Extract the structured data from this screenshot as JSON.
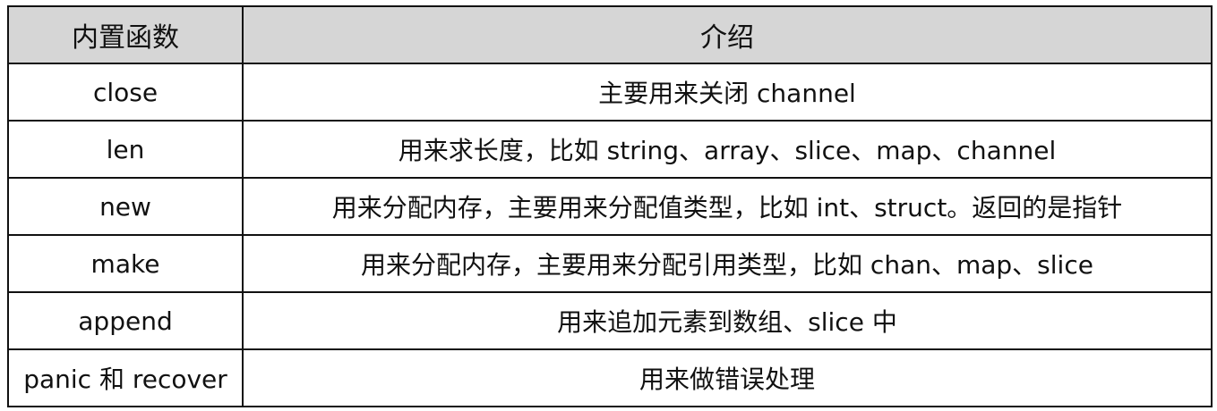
{
  "table": {
    "headers": [
      "内置函数",
      "介绍"
    ],
    "rows": [
      {
        "name": "close",
        "desc": "主要用来关闭 channel"
      },
      {
        "name": "len",
        "desc": "用来求长度，比如 string、array、slice、map、channel"
      },
      {
        "name": "new",
        "desc": "用来分配内存，主要用来分配值类型，比如 int、struct。返回的是指针"
      },
      {
        "name": "make",
        "desc": "用来分配内存，主要用来分配引用类型，比如 chan、map、slice"
      },
      {
        "name": "append",
        "desc": "用来追加元素到数组、slice 中"
      },
      {
        "name": "panic 和 recover",
        "desc": "用来做错误处理"
      }
    ]
  },
  "colors": {
    "header_bg": "#d6d6d6",
    "border": "#111111",
    "text": "#111111"
  }
}
